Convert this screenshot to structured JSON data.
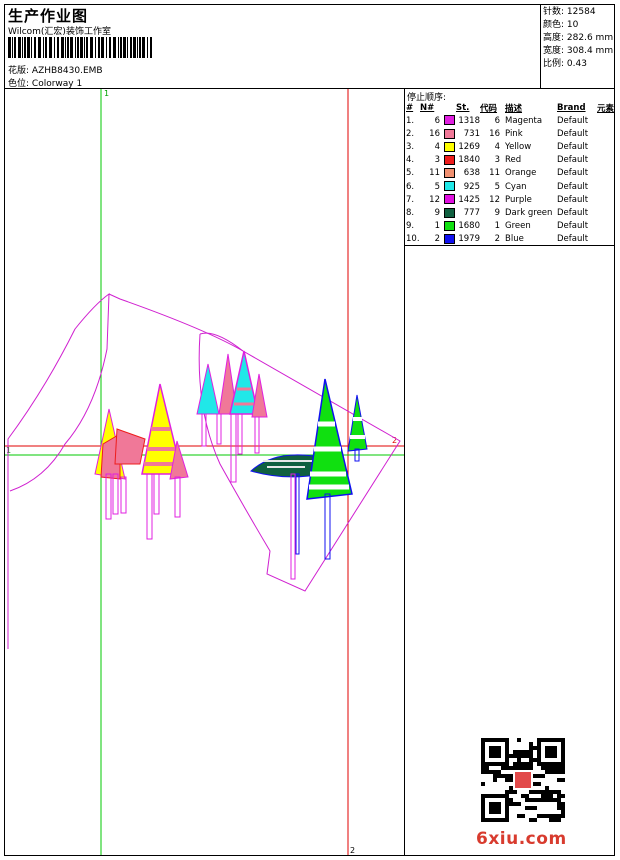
{
  "header": {
    "title": "生产作业图",
    "subtitle": "Wilcom(汇宏)装饰工作室",
    "design_label": "花版:",
    "design_value": "AZHB8430.EMB",
    "colorway_label": "色位:",
    "colorway_value": "Colorway 1"
  },
  "stats": {
    "stitches_label": "针数:",
    "stitches_value": "12584",
    "colors_label": "颜色:",
    "colors_value": "10",
    "height_label": "高度:",
    "height_value": "282.6 mm",
    "width_label": "宽度:",
    "width_value": "308.4 mm",
    "scale_label": "比例:",
    "scale_value": "0.43"
  },
  "legend": {
    "title": "停止顺序:",
    "headers": {
      "idx": "#",
      "n": "N#",
      "st": "St.",
      "code": "代码",
      "desc": "描述",
      "brand": "Brand",
      "elem": "元素"
    },
    "rows": [
      {
        "idx": "1.",
        "n": "6",
        "color": "#e020e0",
        "st": "1318",
        "code": "6",
        "desc": "Magenta",
        "brand": "Default"
      },
      {
        "idx": "2.",
        "n": "16",
        "color": "#f07898",
        "st": "731",
        "code": "16",
        "desc": "Pink",
        "brand": "Default"
      },
      {
        "idx": "3.",
        "n": "4",
        "color": "#ffff00",
        "st": "1269",
        "code": "4",
        "desc": "Yellow",
        "brand": "Default"
      },
      {
        "idx": "4.",
        "n": "3",
        "color": "#ee1c1c",
        "st": "1840",
        "code": "3",
        "desc": "Red",
        "brand": "Default"
      },
      {
        "idx": "5.",
        "n": "11",
        "color": "#f09070",
        "st": "638",
        "code": "11",
        "desc": "Orange",
        "brand": "Default"
      },
      {
        "idx": "6.",
        "n": "5",
        "color": "#20e8e8",
        "st": "925",
        "code": "5",
        "desc": "Cyan",
        "brand": "Default"
      },
      {
        "idx": "7.",
        "n": "12",
        "color": "#e010e0",
        "st": "1425",
        "code": "12",
        "desc": "Purple",
        "brand": "Default"
      },
      {
        "idx": "8.",
        "n": "9",
        "color": "#106040",
        "st": "777",
        "code": "9",
        "desc": "Dark green",
        "brand": "Default"
      },
      {
        "idx": "9.",
        "n": "1",
        "color": "#10e010",
        "st": "1680",
        "code": "1",
        "desc": "Green",
        "brand": "Default"
      },
      {
        "idx": "10.",
        "n": "2",
        "color": "#1010f0",
        "st": "1979",
        "code": "2",
        "desc": "Blue",
        "brand": "Default"
      }
    ]
  },
  "guides": {
    "v1_label": "1",
    "v2_label": "2",
    "h1_label": "1",
    "h2_label": "2"
  },
  "watermark": "6xiu.com"
}
